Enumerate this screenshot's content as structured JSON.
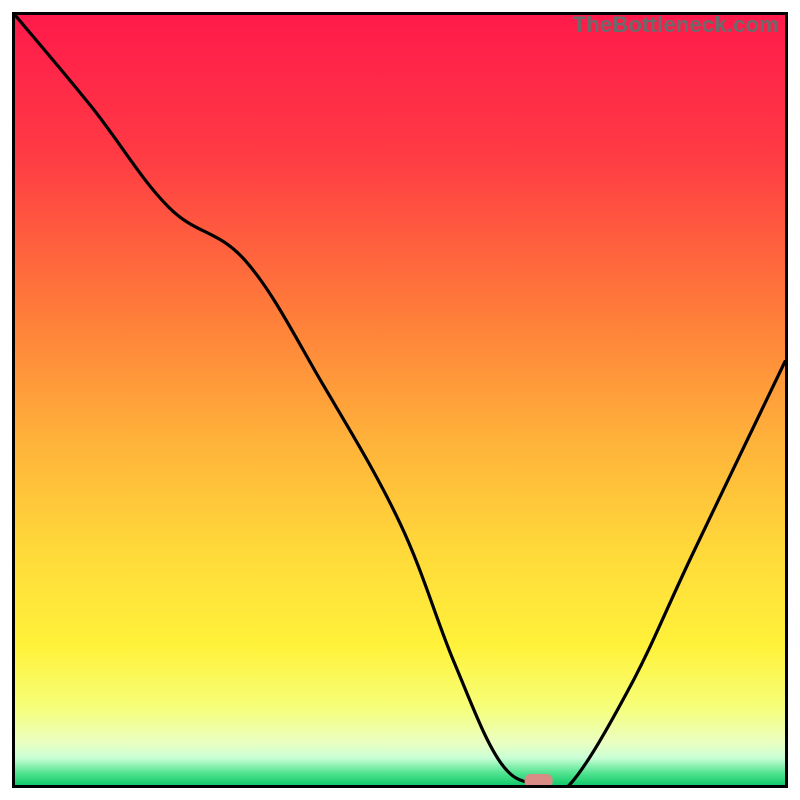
{
  "watermark": "TheBottleneck.com",
  "chart_data": {
    "type": "line",
    "title": "",
    "xlabel": "",
    "ylabel": "",
    "xlim": [
      0,
      100
    ],
    "ylim": [
      0,
      100
    ],
    "grid": false,
    "series": [
      {
        "name": "bottleneck-curve",
        "x": [
          0,
          10,
          20,
          30,
          40,
          50,
          57,
          63,
          68,
          72,
          80,
          88,
          100
        ],
        "y": [
          100,
          88,
          75,
          68,
          52,
          34,
          16,
          3,
          0,
          0,
          13,
          30,
          55
        ]
      }
    ],
    "marker": {
      "x": 68,
      "y": 0,
      "color": "#d98b86",
      "shape": "rounded-rect"
    },
    "background_gradient": {
      "stops": [
        {
          "pos": 0.0,
          "color": "#ff1a4b"
        },
        {
          "pos": 0.18,
          "color": "#ff3a44"
        },
        {
          "pos": 0.38,
          "color": "#ff7a3a"
        },
        {
          "pos": 0.55,
          "color": "#ffb13a"
        },
        {
          "pos": 0.7,
          "color": "#ffda3a"
        },
        {
          "pos": 0.82,
          "color": "#fff23a"
        },
        {
          "pos": 0.9,
          "color": "#f6ff7a"
        },
        {
          "pos": 0.945,
          "color": "#eaffc2"
        },
        {
          "pos": 0.965,
          "color": "#c9ffd6"
        },
        {
          "pos": 0.985,
          "color": "#4fe28f"
        },
        {
          "pos": 1.0,
          "color": "#14c96b"
        }
      ]
    }
  }
}
